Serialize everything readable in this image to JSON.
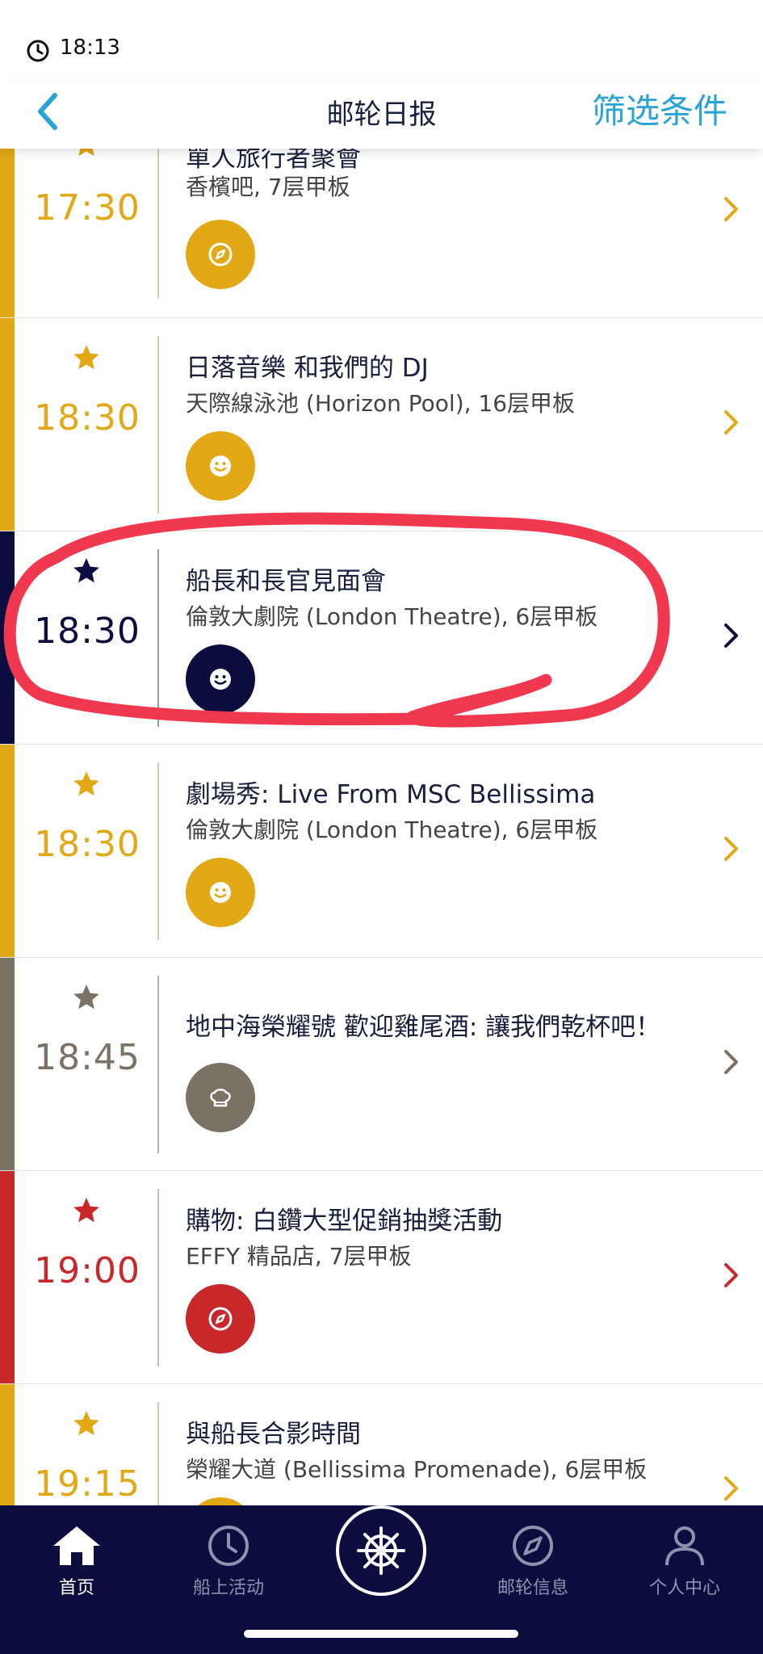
{
  "status_bar": {
    "time": "18:13"
  },
  "header": {
    "title": "邮轮日报",
    "filter_label": "筛选条件"
  },
  "events": [
    {
      "time": "17:30",
      "title": "單人旅行者聚會",
      "location": "香檳吧, 7层甲板",
      "color": "#e2a816",
      "badge_icon": "compass-icon"
    },
    {
      "time": "18:30",
      "title": "日落音樂 和我們的 DJ",
      "location": "天際線泳池 (Horizon Pool), 16层甲板",
      "color": "#e2a816",
      "badge_icon": "smiley-icon"
    },
    {
      "time": "18:30",
      "title": "船長和長官見面會",
      "location": "倫敦大劇院 (London Theatre), 6层甲板",
      "color": "#0d0c3e",
      "badge_icon": "smiley-icon"
    },
    {
      "time": "18:30",
      "title": "劇場秀: Live From MSC Bellissima",
      "location": "倫敦大劇院 (London Theatre), 6层甲板",
      "color": "#e2a816",
      "badge_icon": "smiley-icon"
    },
    {
      "time": "18:45",
      "title": "地中海榮耀號 歡迎雞尾酒: 讓我們乾杯吧！",
      "location": "",
      "color": "#7a7265",
      "badge_icon": "chef-hat-icon"
    },
    {
      "time": "19:00",
      "title": "購物: 白鑽大型促銷抽獎活動",
      "location": "EFFY 精品店, 7层甲板",
      "color": "#c8282a",
      "badge_icon": "compass-icon"
    },
    {
      "time": "19:15",
      "title": "與船長合影時間",
      "location": "榮耀大道 (Bellissima Promenade), 6层甲板",
      "color": "#e2a816",
      "badge_icon": "smiley-icon"
    }
  ],
  "nav": {
    "home": "首页",
    "activities": "船上活动",
    "cruise_info": "邮轮信息",
    "profile": "个人中心"
  }
}
